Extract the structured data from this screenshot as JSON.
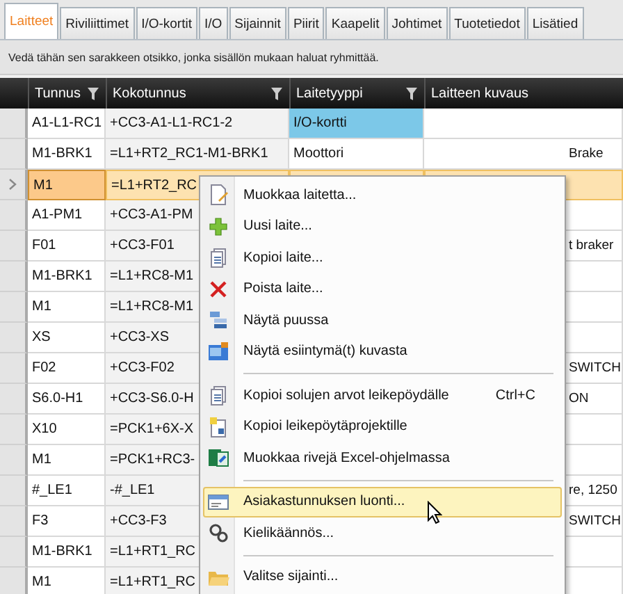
{
  "tabs": [
    {
      "label": "Laitteet",
      "selected": true
    },
    {
      "label": "Riviliittimet",
      "selected": false
    },
    {
      "label": "I/O-kortit",
      "selected": false
    },
    {
      "label": "I/O",
      "selected": false
    },
    {
      "label": "Sijainnit",
      "selected": false
    },
    {
      "label": "Piirit",
      "selected": false
    },
    {
      "label": "Kaapelit",
      "selected": false
    },
    {
      "label": "Johtimet",
      "selected": false
    },
    {
      "label": "Tuotetiedot",
      "selected": false
    },
    {
      "label": "Lisätied",
      "selected": false
    }
  ],
  "group_panel": {
    "hint": "Vedä tähän sen sarakkeen otsikko, jonka sisällön mukaan haluat ryhmittää."
  },
  "table": {
    "columns": [
      {
        "label": "Tunnus",
        "filter": true
      },
      {
        "label": "Kokotunnus",
        "filter": true
      },
      {
        "label": "Laitetyyppi",
        "filter": true
      },
      {
        "label": "Laitteen kuvaus",
        "filter": false
      }
    ],
    "rows": [
      {
        "selected": false,
        "cells": [
          "A1-L1-RC1",
          "+CC3-A1-L1-RC1-2",
          "I/O-kortti",
          ""
        ],
        "type_highlight": true
      },
      {
        "selected": false,
        "cells": [
          "M1-BRK1",
          "=L1+RT2_RC1-M1-BRK1",
          "Moottori",
          "Brake"
        ],
        "type_highlight": false
      },
      {
        "selected": true,
        "cells": [
          "M1",
          "=L1+RT2_RC",
          "",
          ""
        ]
      },
      {
        "selected": false,
        "cells": [
          "A1-PM1",
          "+CC3-A1-PM",
          "",
          ""
        ]
      },
      {
        "selected": false,
        "cells": [
          "F01",
          "+CC3-F01",
          "",
          "t braker"
        ]
      },
      {
        "selected": false,
        "cells": [
          "M1-BRK1",
          "=L1+RC8-M1",
          "",
          ""
        ]
      },
      {
        "selected": false,
        "cells": [
          "M1",
          "=L1+RC8-M1",
          "",
          ""
        ]
      },
      {
        "selected": false,
        "cells": [
          "XS",
          "+CC3-XS",
          "",
          ""
        ]
      },
      {
        "selected": false,
        "cells": [
          "F02",
          "+CC3-F02",
          "",
          "SWITCH"
        ]
      },
      {
        "selected": false,
        "cells": [
          "S6.0-H1",
          "+CC3-S6.0-H",
          "",
          "ON"
        ]
      },
      {
        "selected": false,
        "cells": [
          "X10",
          "=PCK1+6X-X",
          "",
          ""
        ]
      },
      {
        "selected": false,
        "cells": [
          "M1",
          "=PCK1+RC3-",
          "",
          ""
        ]
      },
      {
        "selected": false,
        "cells": [
          "#_LE1",
          "-#_LE1",
          "",
          "re, 1250"
        ]
      },
      {
        "selected": false,
        "cells": [
          "F3",
          "+CC3-F3",
          "",
          "SWITCH"
        ]
      },
      {
        "selected": false,
        "cells": [
          "M1-BRK1",
          "=L1+RT1_RC",
          "",
          ""
        ]
      },
      {
        "selected": false,
        "cells": [
          "M1",
          "=L1+RT1_RC",
          "",
          ""
        ]
      }
    ]
  },
  "context_menu": {
    "items": [
      {
        "kind": "item",
        "label": "Muokkaa laitetta...",
        "selected": false
      },
      {
        "kind": "item",
        "label": "Uusi laite...",
        "selected": false
      },
      {
        "kind": "item",
        "label": "Kopioi laite...",
        "selected": false
      },
      {
        "kind": "item",
        "label": "Poista laite...",
        "selected": false
      },
      {
        "kind": "item",
        "label": "Näytä puussa",
        "selected": false
      },
      {
        "kind": "item",
        "label": "Näytä esiintymä(t) kuvasta",
        "selected": false
      },
      {
        "kind": "separator"
      },
      {
        "kind": "item",
        "label": "Kopioi solujen arvot leikepöydälle",
        "shortcut": "Ctrl+C",
        "selected": false
      },
      {
        "kind": "item",
        "label": "Kopioi leikepöytäprojektille",
        "selected": false
      },
      {
        "kind": "item",
        "label": "Muokkaa rivejä Excel-ohjelmassa",
        "selected": false
      },
      {
        "kind": "separator"
      },
      {
        "kind": "item",
        "label": "Asiakastunnuksen luonti...",
        "selected": true
      },
      {
        "kind": "item",
        "label": "Kielikäännös...",
        "selected": false
      },
      {
        "kind": "separator"
      },
      {
        "kind": "item",
        "label": "Valitse sijainti...",
        "selected": false
      }
    ]
  }
}
